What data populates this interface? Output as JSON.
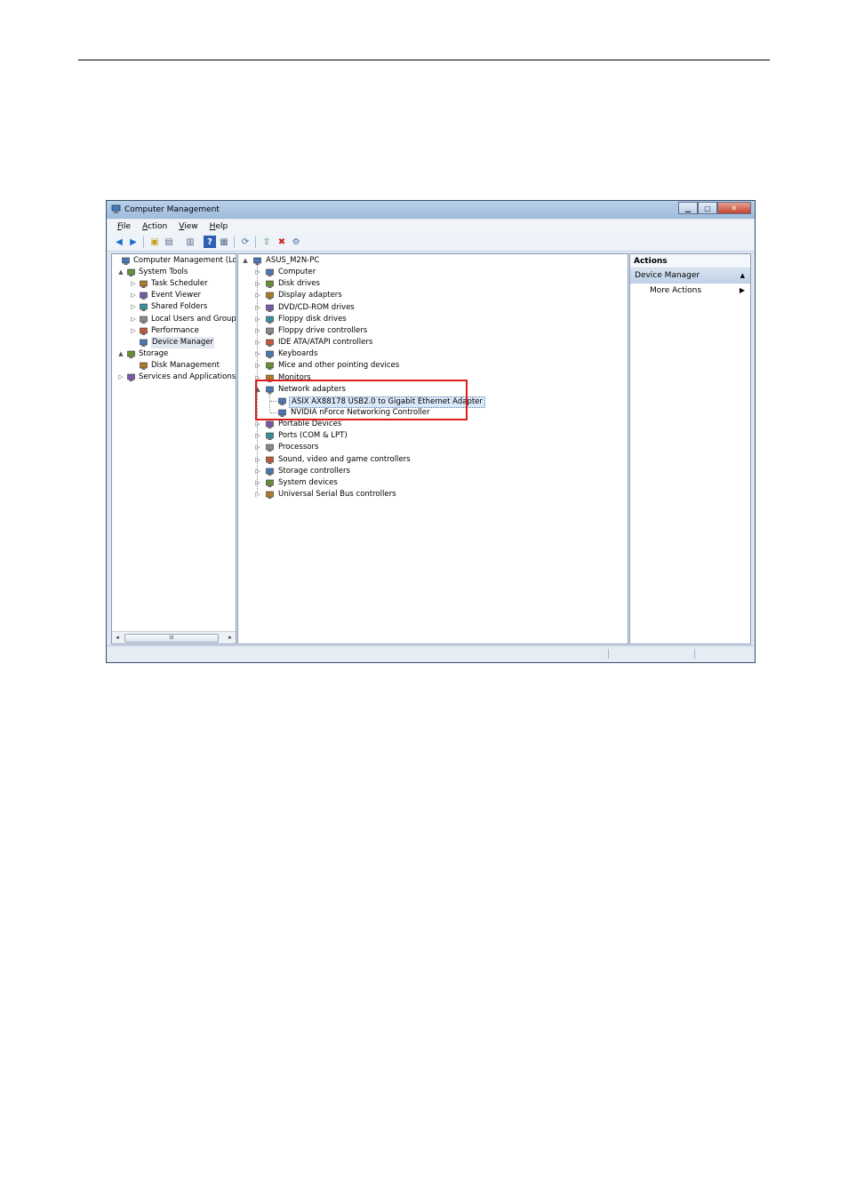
{
  "window": {
    "title": "Computer Management"
  },
  "menu": [
    {
      "label": "File",
      "key": "F",
      "rest": "ile"
    },
    {
      "label": "Action",
      "key": "A",
      "rest": "ction"
    },
    {
      "label": "View",
      "key": "V",
      "rest": "iew"
    },
    {
      "label": "Help",
      "key": "H",
      "rest": "elp"
    }
  ],
  "left_tree": [
    {
      "label": "Computer Management (Local",
      "icon": "computer-management-icon",
      "level": 0,
      "expander": ""
    },
    {
      "label": "System Tools",
      "icon": "tools-icon",
      "level": 1,
      "expander": "▲"
    },
    {
      "label": "Task Scheduler",
      "icon": "clock-icon",
      "level": 2,
      "expander": "▷"
    },
    {
      "label": "Event Viewer",
      "icon": "event-viewer-icon",
      "level": 2,
      "expander": "▷"
    },
    {
      "label": "Shared Folders",
      "icon": "shared-folder-icon",
      "level": 2,
      "expander": "▷"
    },
    {
      "label": "Local Users and Groups",
      "icon": "users-icon",
      "level": 2,
      "expander": "▷"
    },
    {
      "label": "Performance",
      "icon": "performance-icon",
      "level": 2,
      "expander": "▷"
    },
    {
      "label": "Device Manager",
      "icon": "device-manager-icon",
      "level": 2,
      "expander": ""
    },
    {
      "label": "Storage",
      "icon": "storage-icon",
      "level": 1,
      "expander": "▲"
    },
    {
      "label": "Disk Management",
      "icon": "disk-icon",
      "level": 2,
      "expander": ""
    },
    {
      "label": "Services and Applications",
      "icon": "services-icon",
      "level": 1,
      "expander": "▷"
    }
  ],
  "device_tree": {
    "root": "ASUS_M2N-PC",
    "categories": [
      {
        "label": "Computer",
        "icon": "computer-icon"
      },
      {
        "label": "Disk drives",
        "icon": "disk-drive-icon"
      },
      {
        "label": "Display adapters",
        "icon": "display-adapter-icon"
      },
      {
        "label": "DVD/CD-ROM drives",
        "icon": "dvd-icon"
      },
      {
        "label": "Floppy disk drives",
        "icon": "floppy-icon"
      },
      {
        "label": "Floppy drive controllers",
        "icon": "floppy-controller-icon"
      },
      {
        "label": "IDE ATA/ATAPI controllers",
        "icon": "ide-icon"
      },
      {
        "label": "Keyboards",
        "icon": "keyboard-icon"
      },
      {
        "label": "Mice and other pointing devices",
        "icon": "mouse-icon"
      },
      {
        "label": "Monitors",
        "icon": "monitor-icon"
      }
    ],
    "network": {
      "label": "Network adapters",
      "children": [
        "ASIX AX88178 USB2.0 to Gigabit Ethernet Adapter",
        "NVIDIA nForce Networking Controller"
      ]
    },
    "categories_after": [
      {
        "label": "Portable Devices",
        "icon": "portable-device-icon"
      },
      {
        "label": "Ports (COM & LPT)",
        "icon": "port-icon"
      },
      {
        "label": "Processors",
        "icon": "processor-icon"
      },
      {
        "label": "Sound, video and game controllers",
        "icon": "sound-icon"
      },
      {
        "label": "Storage controllers",
        "icon": "storage-controller-icon"
      },
      {
        "label": "System devices",
        "icon": "system-device-icon"
      },
      {
        "label": "Universal Serial Bus controllers",
        "icon": "usb-icon"
      }
    ]
  },
  "actions": {
    "header": "Actions",
    "section": "Device Manager",
    "more": "More Actions"
  },
  "colors": {
    "highlight_box": "#e01b1b",
    "titlebar": "#9fbbdb"
  }
}
